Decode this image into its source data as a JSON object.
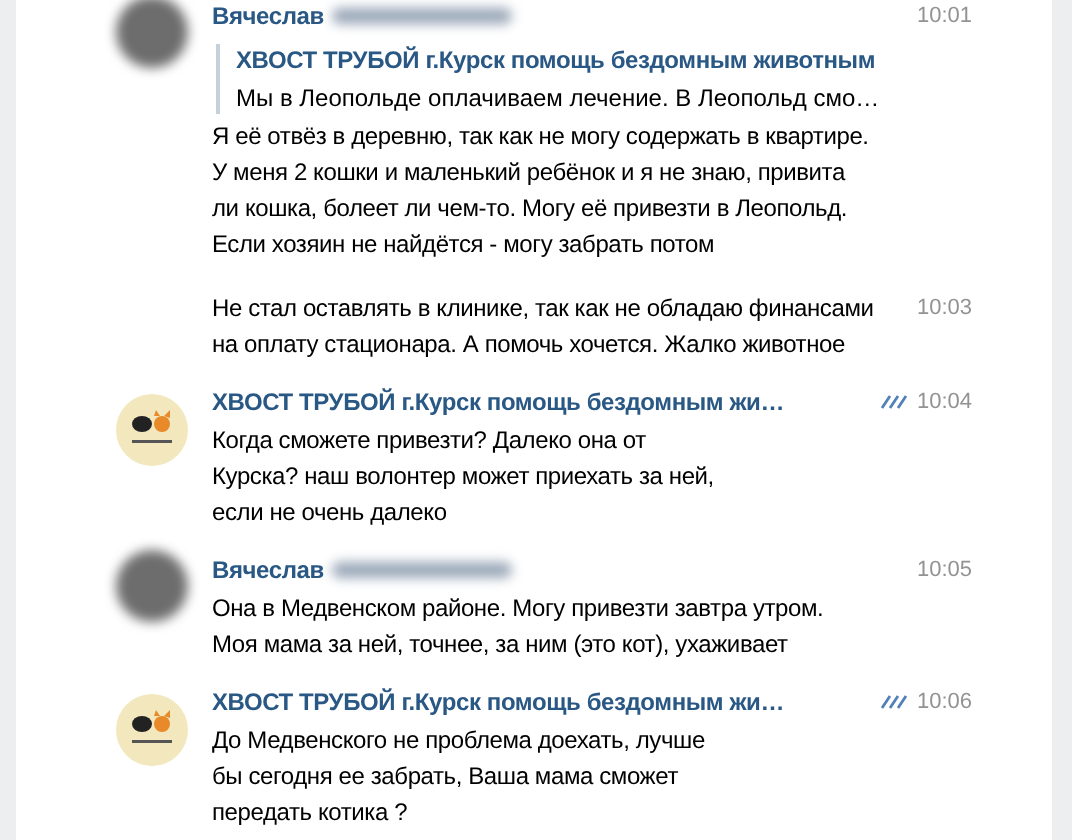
{
  "messages": [
    {
      "sender": "Вячеслав",
      "kind": "blurred",
      "time": "10:01",
      "read": false,
      "quote": {
        "author": "ХВОСТ ТРУБОЙ г.Курск помощь бездомным животным",
        "text": "Мы в Леопольде оплачиваем лечение. В Леопольд смо…"
      },
      "parts": [
        {
          "text": "Я её отвёз в деревню, так как не могу содержать в квартире.\nУ меня 2 кошки и маленький ребёнок и я не знаю, привита\nли кошка, болеет ли чем-то. Могу её привезти в Леопольд.\nЕсли хозяин не найдётся - могу забрать потом"
        },
        {
          "text": "Не стал оставлять в клинике, так как не обладаю финансами\nна оплату стационара. А помочь хочется. Жалко животное",
          "time": "10:03"
        }
      ]
    },
    {
      "sender": "ХВОСТ ТРУБОЙ г.Курск помощь бездомным жи…",
      "kind": "logo",
      "time": "10:04",
      "read": true,
      "parts": [
        {
          "text": "Когда сможете привезти? Далеко она от\nКурска? наш волонтер может приехать за ней,\nесли не очень далеко"
        }
      ]
    },
    {
      "sender": "Вячеслав",
      "kind": "blurred",
      "time": "10:05",
      "read": false,
      "parts": [
        {
          "text": "Она в Медвенском районе. Могу привезти завтра утром.\nМоя мама за ней, точнее, за ним (это кот), ухаживает"
        }
      ]
    },
    {
      "sender": "ХВОСТ ТРУБОЙ г.Курск помощь бездомным жи…",
      "kind": "logo",
      "time": "10:06",
      "read": true,
      "parts": [
        {
          "text": "До Медвенского не проблема доехать, лучше\nбы сегодня ее забрать, Ваша мама сможет\nпередать котика ?"
        }
      ]
    }
  ]
}
